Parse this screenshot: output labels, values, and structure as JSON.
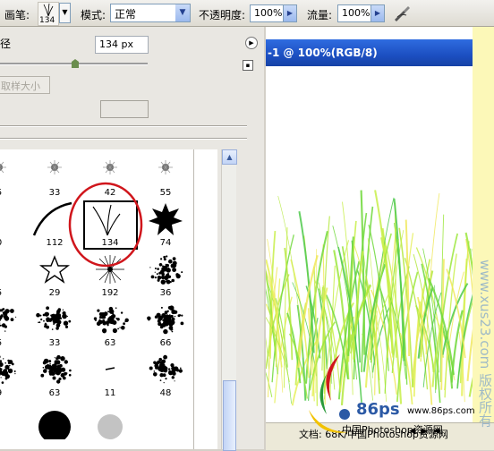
{
  "options_bar": {
    "brush_label": "画笔:",
    "brush_size": "134",
    "mode_label": "模式:",
    "mode_value": "正常",
    "opacity_label": "不透明度:",
    "opacity_value": "100%",
    "flow_label": "流量:",
    "flow_value": "100%"
  },
  "brush_panel": {
    "diameter_label": "径",
    "diameter_value": "134 px",
    "sample_button": "取样大小",
    "brushes": [
      {
        "num": "5"
      },
      {
        "num": "33"
      },
      {
        "num": "42"
      },
      {
        "num": "55"
      },
      {
        "num": "0"
      },
      {
        "num": "112"
      },
      {
        "num": "134"
      },
      {
        "num": "74"
      },
      {
        "num": "5"
      },
      {
        "num": "29"
      },
      {
        "num": "192"
      },
      {
        "num": "36"
      },
      {
        "num": "5"
      },
      {
        "num": "33"
      },
      {
        "num": "63"
      },
      {
        "num": "66"
      },
      {
        "num": "9"
      },
      {
        "num": "63"
      },
      {
        "num": "11"
      },
      {
        "num": "48"
      },
      {
        "num": ""
      },
      {
        "num": ""
      },
      {
        "num": ""
      },
      {
        "num": ""
      }
    ]
  },
  "document": {
    "title": "-1 @ 100%(RGB/8)",
    "status_text": "文档:   68K/中国Photoshop资源网"
  },
  "watermark": {
    "vertical": "www.xus23.com 版权所有",
    "logo_text": "86ps",
    "logo_url": "www.86ps.com",
    "logo_cn": "中国Photoshop资源网"
  },
  "colors": {
    "title_bar": "#1c4fc1",
    "highlight_circle": "#d0161c",
    "grass": "#8fe23a"
  }
}
